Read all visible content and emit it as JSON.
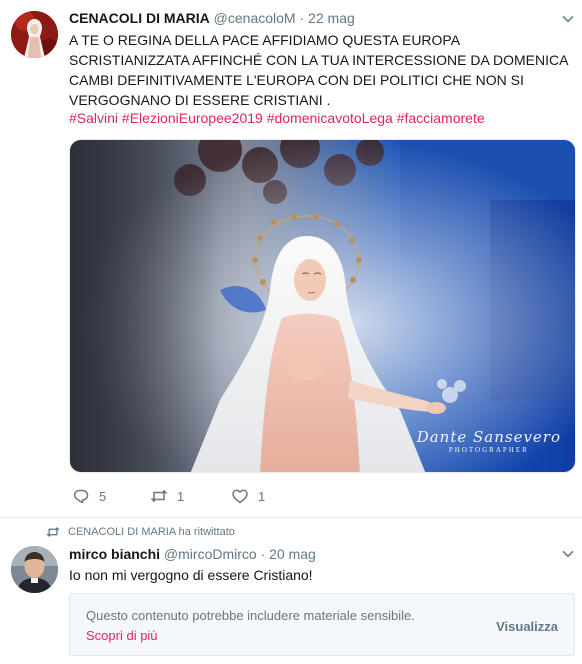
{
  "tweet": {
    "display_name": "CENACOLI DI MARIA",
    "handle": "@cenacoloM",
    "separator": "·",
    "date": "22 mag",
    "text": "A TE O REGINA DELLA PACE AFFIDIAMO QUESTA EUROPA SCRISTIANIZZATA AFFINCHÉ CON LA TUA INTERCESSIONE DA DOMENICA CAMBI DEFINITIVAMENTE L'EUROPA CON DEI POLITICI CHE NON SI VERGOGNANO DI ESSERE CRISTIANI .",
    "hashtags": [
      "#Salvini",
      "#ElezioniEuropee2019",
      "#domenicavotoLega",
      "#facciamorete"
    ],
    "media": {
      "watermark_signature": "Dante Sansevero",
      "watermark_caption": "PHOTOGRAPHER"
    },
    "actions": {
      "reply_count": "5",
      "retweet_count": "1",
      "like_count": "1"
    }
  },
  "retweet_context": {
    "text": "CENACOLI DI MARIA ha ritwittato"
  },
  "tweet2": {
    "display_name": "mirco bianchi",
    "handle": "@mircoDmirco",
    "separator": "·",
    "date": "20 mag",
    "text": "Io non mi vergogno di essere Cristiano!",
    "sensitive": {
      "message": "Questo contenuto potrebbe includere materiale sensibile.",
      "learn_more": "Scopri di più",
      "view_button": "Visualizza"
    }
  },
  "colors": {
    "accent": "#e0245e",
    "muted": "#657786",
    "text": "#14171a",
    "border": "#e6ecf0"
  },
  "icons": [
    "chevron-down-icon",
    "reply-icon",
    "retweet-icon",
    "heart-icon"
  ]
}
